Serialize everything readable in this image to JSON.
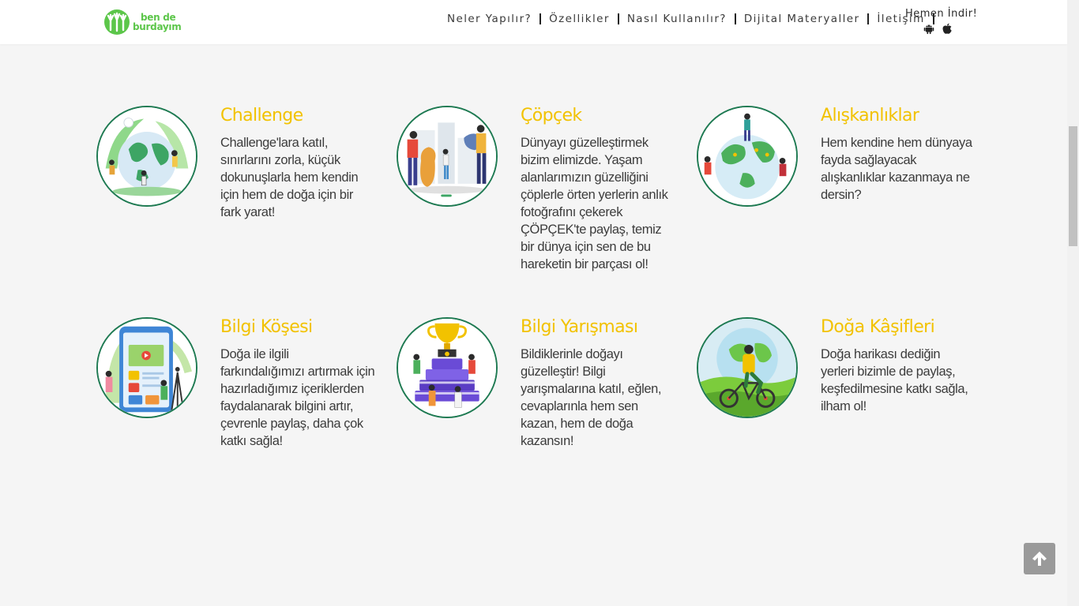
{
  "brand": {
    "logo_line1": "ben de",
    "logo_line2": "burdayım",
    "color": "#5cc64a"
  },
  "nav": {
    "items": [
      {
        "label": "Neler Yapılır?"
      },
      {
        "label": "Özellikler"
      },
      {
        "label": "Nasıl Kullanılır?"
      },
      {
        "label": "Dijital Materyaller"
      },
      {
        "label": "İletişim"
      }
    ]
  },
  "download": {
    "label": "Hemen İndir!",
    "icons": [
      "android-icon",
      "apple-icon"
    ]
  },
  "features": [
    {
      "title": "Challenge",
      "desc": "Challenge'lara katıl, sınırlarını zorla, küçük dokunuşlarla hem kendin için hem de doğa için bir fark yarat!",
      "icon": "earth-challenge-illustration"
    },
    {
      "title": "Çöpçek",
      "desc": "Dünyayı güzelleştirmek bizim elimizde. Yaşam alanlarımızın güzelliğini çöplerle örten yerlerin anlık fotoğrafını çekerek ÇÖPÇEK'te paylaş, temiz bir dünya için sen de bu hareketin bir parçası ol!",
      "icon": "trash-collection-illustration"
    },
    {
      "title": "Alışkanlıklar",
      "desc": "Hem kendine hem dünyaya fayda sağlayacak alışkanlıklar kazanmaya ne dersin?",
      "icon": "earth-habits-illustration"
    },
    {
      "title": "Bilgi Köşesi",
      "desc": "Doğa ile ilgili farkındalığımızı artırmak için hazırladığımız içeriklerden faydalanarak bilgini artır, çevrenle paylaş, daha çok katkı sağla!",
      "icon": "mobile-content-illustration"
    },
    {
      "title": "Bilgi Yarışması",
      "desc": "Bildiklerinle doğayı güzelleştir! Bilgi yarışmalarına katıl, eğlen, cevaplarınla hem sen kazan, hem de doğa kazansın!",
      "icon": "trophy-quiz-illustration"
    },
    {
      "title": "Doğa Kâşifleri",
      "desc": "Doğa harikası dediğin yerleri bizimle de paylaş, keşfedilmesine katkı sağla, ilham ol!",
      "icon": "bicycle-explorer-illustration"
    }
  ],
  "colors": {
    "title": "#f2c200",
    "circle_border": "#1e7a52",
    "background": "#f5f5f5"
  },
  "scroll_top": {
    "icon": "arrow-up-icon"
  }
}
